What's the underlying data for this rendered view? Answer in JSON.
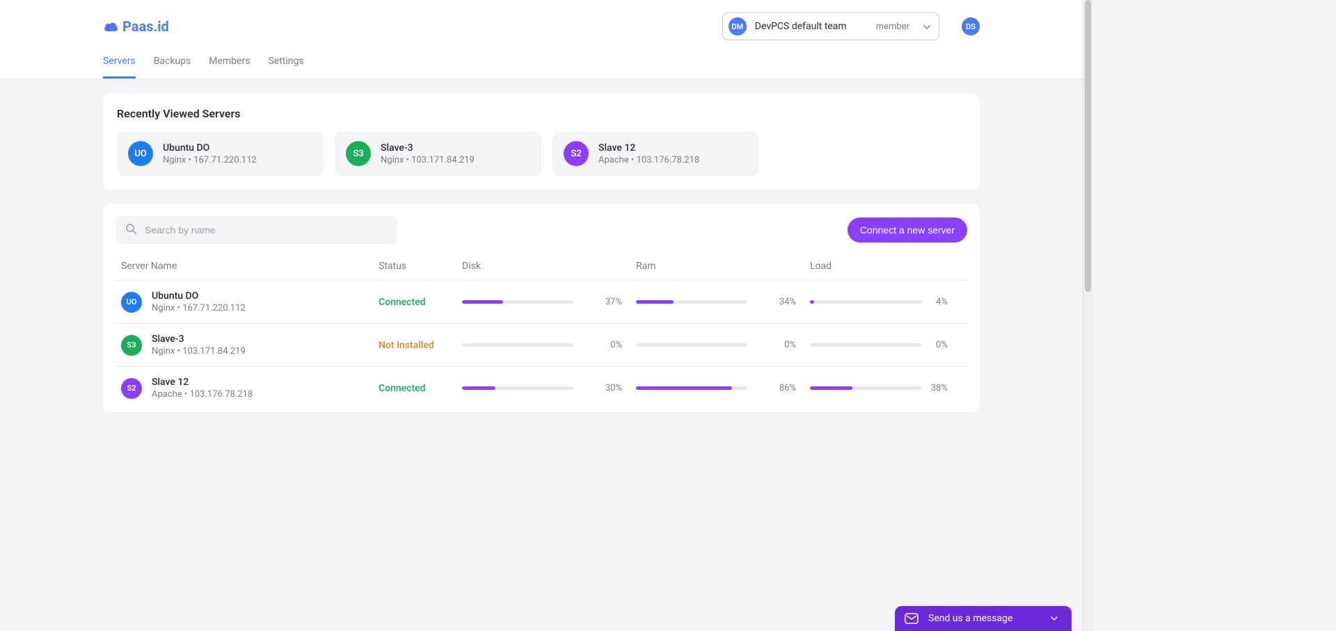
{
  "brand": "Paas.id",
  "team": {
    "avatar": "DM",
    "name": "DevPCS default team",
    "role": "member"
  },
  "user_avatar": "DS",
  "nav": [
    {
      "label": "Servers",
      "active": true
    },
    {
      "label": "Backups",
      "active": false
    },
    {
      "label": "Members",
      "active": false
    },
    {
      "label": "Settings",
      "active": false
    }
  ],
  "recent": {
    "title": "Recently Viewed Servers",
    "items": [
      {
        "badge": "UO",
        "color": "blue",
        "name": "Ubuntu DO",
        "sub": "Nginx  •  167.71.220.112"
      },
      {
        "badge": "S3",
        "color": "green",
        "name": "Slave-3",
        "sub": "Nginx  •  103.171.84.219"
      },
      {
        "badge": "S2",
        "color": "purple",
        "name": "Slave 12",
        "sub": "Apache  •  103.176.78.218"
      }
    ]
  },
  "search_placeholder": "Search by name",
  "connect_label": "Connect a new server",
  "columns": {
    "name": "Server Name",
    "status": "Status",
    "disk": "Disk",
    "ram": "Ram",
    "load": "Load"
  },
  "status_labels": {
    "connected": "Connected",
    "notinstalled": "Not Installed"
  },
  "servers": [
    {
      "badge": "UO",
      "color": "blue",
      "name": "Ubuntu DO",
      "sub": "Nginx  •  167.71.220.112",
      "status": "connected",
      "disk": 37,
      "ram": 34,
      "load": 4
    },
    {
      "badge": "S3",
      "color": "green",
      "name": "Slave-3",
      "sub": "Nginx  •  103.171.84.219",
      "status": "notinstalled",
      "disk": 0,
      "ram": 0,
      "load": 0
    },
    {
      "badge": "S2",
      "color": "purple",
      "name": "Slave 12",
      "sub": "Apache  •  103.176.78.218",
      "status": "connected",
      "disk": 30,
      "ram": 86,
      "load": 38
    }
  ],
  "chat": "Send us a message"
}
